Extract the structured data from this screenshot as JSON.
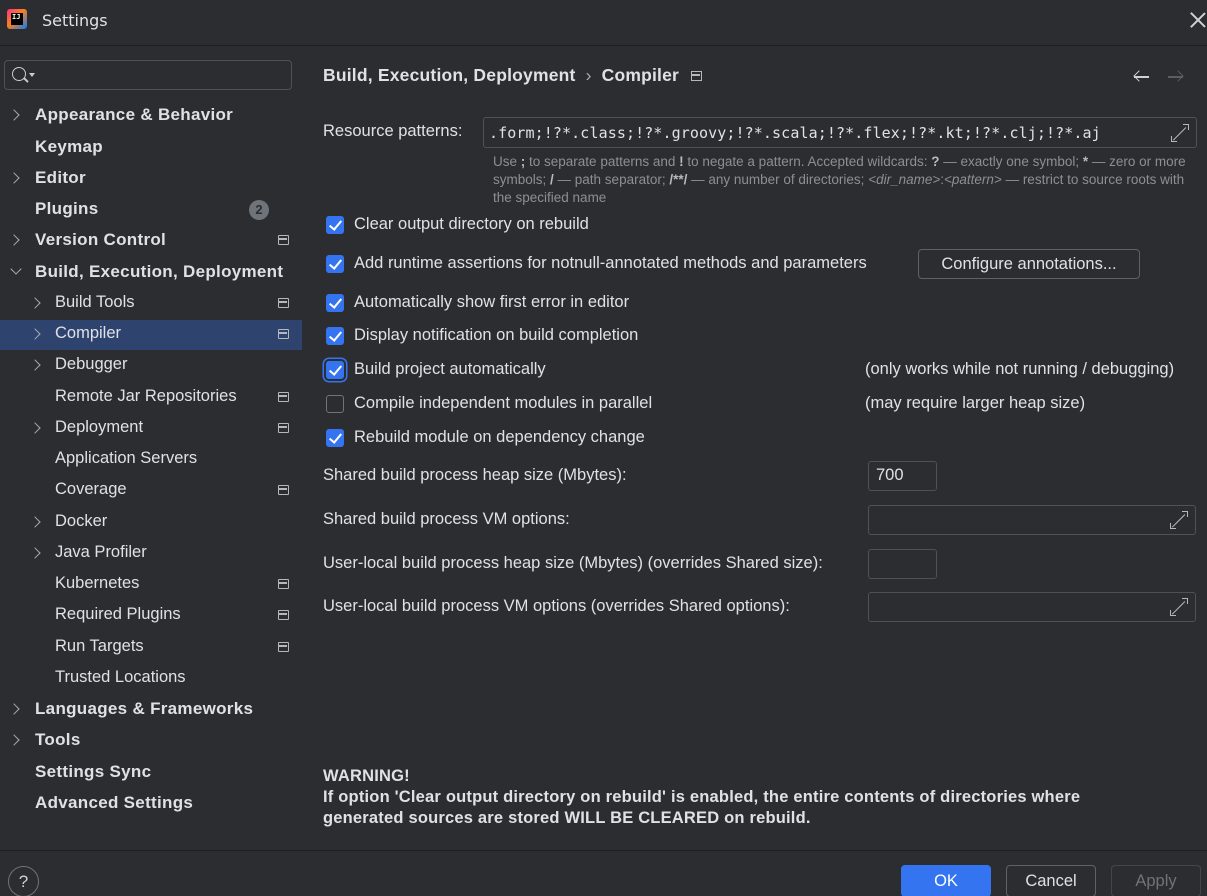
{
  "window": {
    "title": "Settings"
  },
  "sidebar": {
    "search": {
      "placeholder": ""
    },
    "items": [
      {
        "label": "Appearance & Behavior",
        "badge": null
      },
      {
        "label": "Keymap"
      },
      {
        "label": "Editor"
      },
      {
        "label": "Plugins",
        "badge": "2"
      },
      {
        "label": "Version Control"
      },
      {
        "label": "Build, Execution, Deployment"
      },
      {
        "label": "Build Tools"
      },
      {
        "label": "Compiler"
      },
      {
        "label": "Debugger"
      },
      {
        "label": "Remote Jar Repositories"
      },
      {
        "label": "Deployment"
      },
      {
        "label": "Application Servers"
      },
      {
        "label": "Coverage"
      },
      {
        "label": "Docker"
      },
      {
        "label": "Java Profiler"
      },
      {
        "label": "Kubernetes"
      },
      {
        "label": "Required Plugins"
      },
      {
        "label": "Run Targets"
      },
      {
        "label": "Trusted Locations"
      },
      {
        "label": "Languages & Frameworks"
      },
      {
        "label": "Tools"
      },
      {
        "label": "Settings Sync"
      },
      {
        "label": "Advanced Settings"
      }
    ],
    "selected": "Compiler"
  },
  "header": {
    "breadcrumb": [
      "Build, Execution, Deployment",
      "Compiler"
    ],
    "separator": "›"
  },
  "compiler": {
    "resource_patterns_label": "Resource patterns:",
    "resource_patterns_value": ".form;!?*.class;!?*.groovy;!?*.scala;!?*.flex;!?*.kt;!?*.clj;!?*.aj",
    "hint": {
      "p1": "Use ",
      "b1": ";",
      "p2": " to separate patterns and ",
      "b2": "!",
      "p3": " to negate a pattern. Accepted wildcards: ",
      "b3": "?",
      "p4": " — exactly one symbol; ",
      "b4": "*",
      "p5": " — zero or more symbols; ",
      "b5": "/",
      "p6": " — path separator; ",
      "b6": "/**/",
      "p7": " — any number of directories; ",
      "i1": "<dir_name>",
      "p8": ":",
      "i2": "<pattern>",
      "p9": " — restrict to source roots with the specified name"
    },
    "options": [
      {
        "label": "Clear output directory on rebuild",
        "checked": true
      },
      {
        "label": "Add runtime assertions for notnull-annotated methods and parameters",
        "checked": true
      },
      {
        "label": "Automatically show first error in editor",
        "checked": true
      },
      {
        "label": "Display notification on build completion",
        "checked": true
      },
      {
        "label": "Build project automatically",
        "checked": true
      },
      {
        "label": "Compile independent modules in parallel",
        "checked": false
      },
      {
        "label": "Rebuild module on dependency change",
        "checked": true
      }
    ],
    "configure_annotations_label": "Configure annotations...",
    "build_auto_note": "(only works while not running / debugging)",
    "parallel_note": "(may require larger heap size)",
    "shared_heap_label": "Shared build process heap size (Mbytes):",
    "shared_heap_value": "700",
    "shared_vm_label": "Shared build process VM options:",
    "shared_vm_value": "",
    "user_heap_label": "User-local build process heap size (Mbytes) (overrides Shared size):",
    "user_heap_value": "",
    "user_vm_label": "User-local build process VM options (overrides Shared options):",
    "user_vm_value": "",
    "warning_title": "WARNING!",
    "warning_line1": "If option 'Clear output directory on rebuild' is enabled, the entire contents of directories where",
    "warning_line2": "generated sources are stored WILL BE CLEARED on rebuild."
  },
  "footer": {
    "help": "?",
    "ok": "OK",
    "cancel": "Cancel",
    "apply": "Apply"
  },
  "colors": {
    "background": "#2b2d30",
    "selection": "#2e436e",
    "accent": "#3574f0",
    "text": "#dfe1e5",
    "hint": "#8c8f94"
  }
}
